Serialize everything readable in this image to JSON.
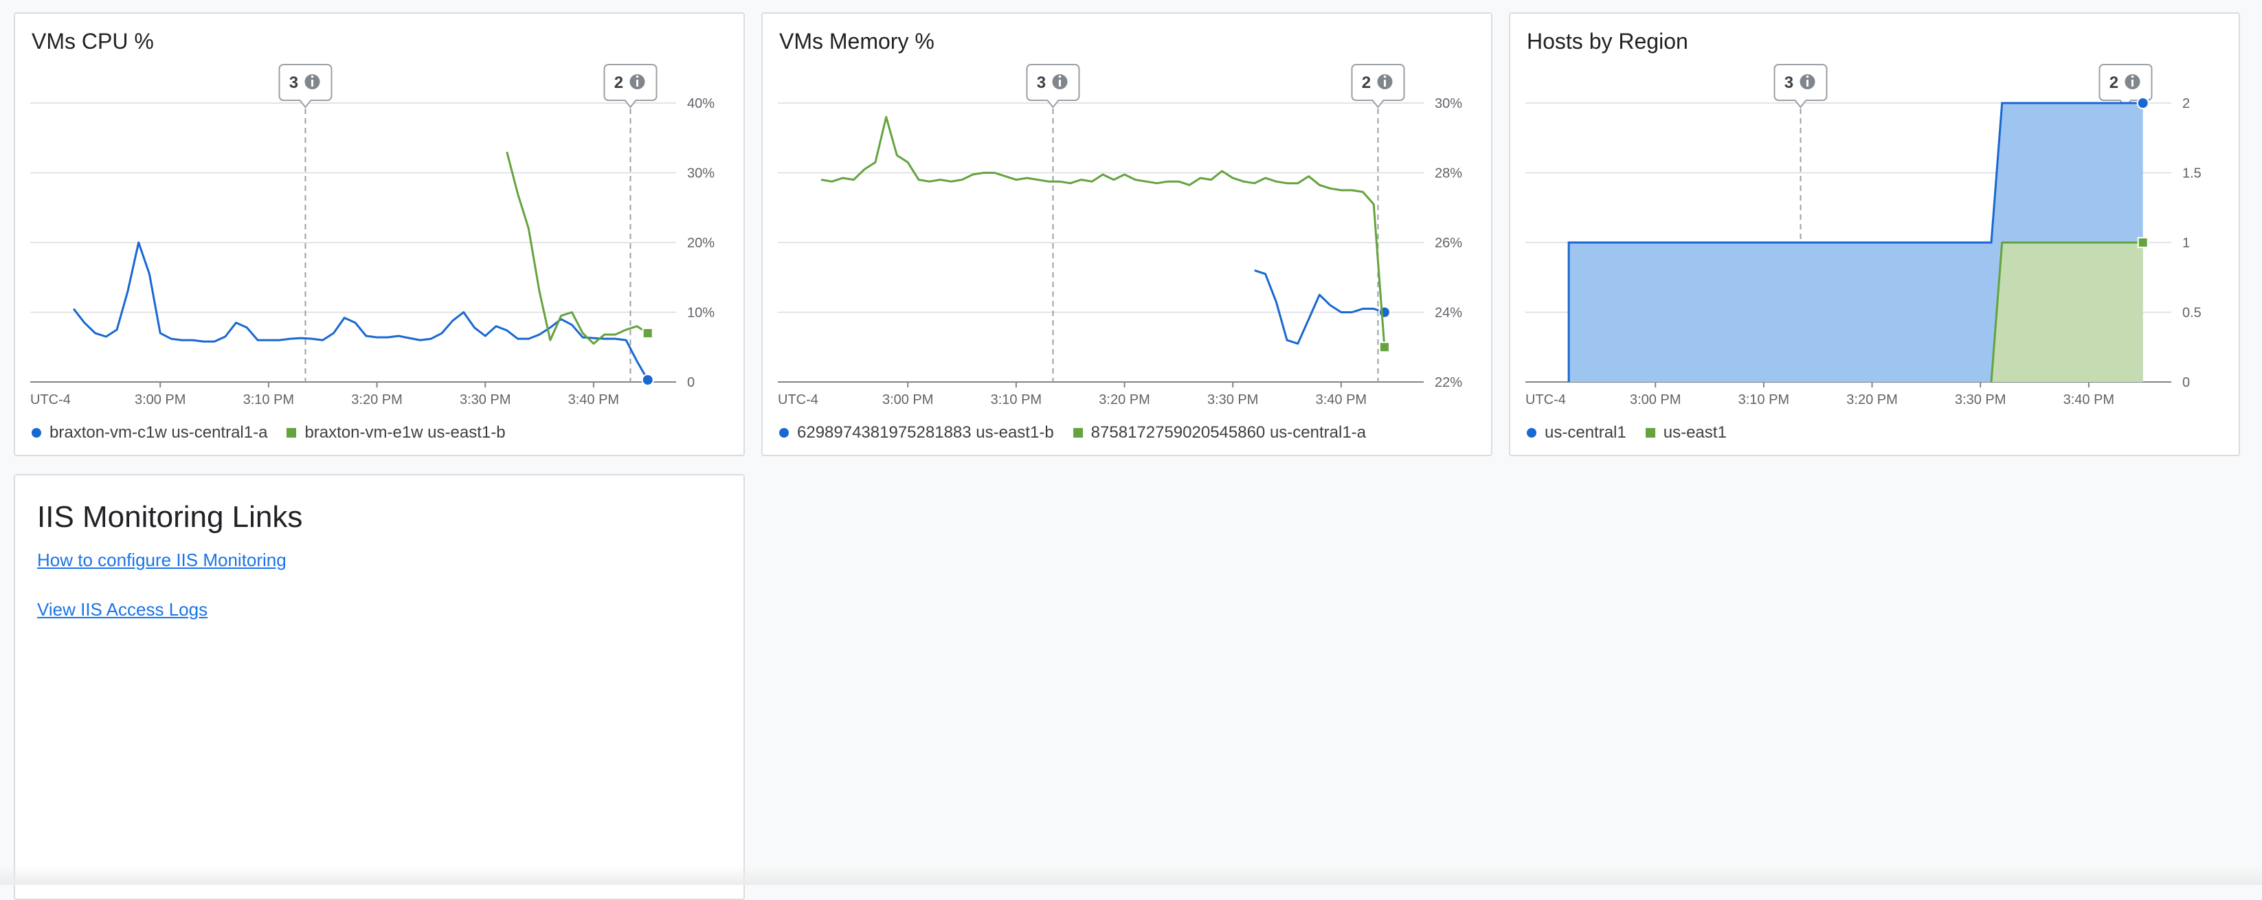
{
  "colors": {
    "blue": "#1967d2",
    "green": "#64a33d",
    "blue_fill": "#9ec5f0",
    "green_fill": "#c5dcb2"
  },
  "cards": [
    {
      "title": "VMs CPU %",
      "legend": [
        {
          "label": "braxton-vm-c1w us-central1-a",
          "shape": "dot",
          "color": "#1967d2"
        },
        {
          "label": "braxton-vm-e1w us-east1-b",
          "shape": "square",
          "color": "#64a33d"
        }
      ]
    },
    {
      "title": "VMs Memory %",
      "legend": [
        {
          "label": "6298974381975281883 us-east1-b",
          "shape": "dot",
          "color": "#1967d2"
        },
        {
          "label": "8758172759020545860 us-central1-a",
          "shape": "square",
          "color": "#64a33d"
        }
      ]
    },
    {
      "title": "Hosts by Region",
      "legend": [
        {
          "label": "us-central1",
          "shape": "dot",
          "color": "#1967d2"
        },
        {
          "label": "us-east1",
          "shape": "square",
          "color": "#64a33d"
        }
      ]
    }
  ],
  "links_card": {
    "title": "IIS Monitoring Links",
    "links": [
      "How to configure IIS Monitoring",
      "View IIS Access Logs"
    ]
  },
  "chart_data": [
    {
      "type": "line",
      "title": "VMs CPU %",
      "x_axis": {
        "timezone_label": "UTC-4",
        "ticks": [
          "3:00 PM",
          "3:10 PM",
          "3:20 PM",
          "3:30 PM",
          "3:40 PM"
        ]
      },
      "xlim": [
        -12,
        48
      ],
      "ylim": [
        0,
        40
      ],
      "y_ticks": [
        0,
        10,
        20,
        30,
        40
      ],
      "y_tick_labels": [
        "0",
        "10%",
        "20%",
        "30%",
        "40%"
      ],
      "annotations": [
        {
          "x": 13.4,
          "label": "3"
        },
        {
          "x": 43.4,
          "label": "2"
        }
      ],
      "series": [
        {
          "name": "braxton-vm-c1w us-central1-a",
          "color": "#1967d2",
          "marker": "dot",
          "x": [
            -8,
            -7,
            -6,
            -5,
            -4,
            -3,
            -2,
            -1,
            0,
            1,
            2,
            3,
            4,
            5,
            6,
            7,
            8,
            9,
            10,
            11,
            12,
            13,
            14,
            15,
            16,
            17,
            18,
            19,
            20,
            21,
            22,
            23,
            24,
            25,
            26,
            27,
            28,
            29,
            30,
            31,
            32,
            33,
            34,
            35,
            36,
            37,
            38,
            39,
            40,
            41,
            42,
            43,
            44,
            45
          ],
          "y": [
            10.5,
            8.5,
            7,
            6.5,
            7.5,
            13,
            20,
            15.5,
            7,
            6.2,
            6,
            6,
            5.8,
            5.8,
            6.5,
            8.5,
            7.8,
            6,
            6,
            6,
            6.2,
            6.3,
            6.2,
            6,
            7,
            9.2,
            8.5,
            6.6,
            6.4,
            6.4,
            6.6,
            6.3,
            6,
            6.2,
            7,
            8.8,
            10,
            7.8,
            6.6,
            8,
            7.4,
            6.2,
            6.2,
            6.8,
            7.8,
            9,
            8.2,
            6.4,
            6.3,
            6.2,
            6.2,
            6,
            3,
            0.3
          ]
        },
        {
          "name": "braxton-vm-e1w us-east1-b",
          "color": "#64a33d",
          "marker": "square",
          "x": [
            32,
            33,
            34,
            35,
            36,
            37,
            38,
            39,
            40,
            41,
            42,
            43,
            44,
            45
          ],
          "y": [
            33,
            27,
            22,
            13,
            6,
            9.5,
            10,
            7,
            5.5,
            6.8,
            6.8,
            7.5,
            8,
            7
          ]
        }
      ]
    },
    {
      "type": "line",
      "title": "VMs Memory %",
      "x_axis": {
        "timezone_label": "UTC-4",
        "ticks": [
          "3:00 PM",
          "3:10 PM",
          "3:20 PM",
          "3:30 PM",
          "3:40 PM"
        ]
      },
      "xlim": [
        -12,
        48
      ],
      "ylim": [
        22,
        30
      ],
      "y_ticks": [
        22,
        24,
        26,
        28,
        30
      ],
      "y_tick_labels": [
        "22%",
        "24%",
        "26%",
        "28%",
        "30%"
      ],
      "annotations": [
        {
          "x": 13.4,
          "label": "3"
        },
        {
          "x": 43.4,
          "label": "2"
        }
      ],
      "series": [
        {
          "name": "6298974381975281883 us-east1-b",
          "color": "#1967d2",
          "marker": "dot",
          "x": [
            32,
            33,
            34,
            35,
            36,
            37,
            38,
            39,
            40,
            41,
            42,
            43,
            44
          ],
          "y": [
            25.2,
            25.1,
            24.3,
            23.2,
            23.1,
            23.8,
            24.5,
            24.2,
            24,
            24,
            24.1,
            24.1,
            24
          ]
        },
        {
          "name": "8758172759020545860 us-central1-a",
          "color": "#64a33d",
          "marker": "square",
          "x": [
            -8,
            -7,
            -6,
            -5,
            -4,
            -3,
            -2,
            -1,
            0,
            1,
            2,
            3,
            4,
            5,
            6,
            7,
            8,
            9,
            10,
            11,
            12,
            13,
            14,
            15,
            16,
            17,
            18,
            19,
            20,
            21,
            22,
            23,
            24,
            25,
            26,
            27,
            28,
            29,
            30,
            31,
            32,
            33,
            34,
            35,
            36,
            37,
            38,
            39,
            40,
            41,
            42,
            43,
            44
          ],
          "y": [
            27.8,
            27.75,
            27.85,
            27.8,
            28.1,
            28.3,
            29.6,
            28.5,
            28.3,
            27.8,
            27.75,
            27.8,
            27.75,
            27.8,
            27.95,
            28,
            28,
            27.9,
            27.8,
            27.85,
            27.8,
            27.75,
            27.75,
            27.7,
            27.8,
            27.75,
            27.95,
            27.8,
            27.95,
            27.8,
            27.75,
            27.7,
            27.75,
            27.75,
            27.65,
            27.85,
            27.8,
            28.05,
            27.85,
            27.75,
            27.7,
            27.85,
            27.75,
            27.7,
            27.7,
            27.9,
            27.65,
            27.55,
            27.5,
            27.5,
            27.45,
            27.1,
            23
          ]
        }
      ]
    },
    {
      "type": "area",
      "title": "Hosts by Region",
      "x_axis": {
        "timezone_label": "UTC-4",
        "ticks": [
          "3:00 PM",
          "3:10 PM",
          "3:20 PM",
          "3:30 PM",
          "3:40 PM"
        ]
      },
      "xlim": [
        -12,
        48
      ],
      "ylim": [
        0,
        2
      ],
      "y_ticks": [
        0,
        0.5,
        1,
        1.5,
        2
      ],
      "y_tick_labels": [
        "0",
        "0.5",
        "1",
        "1.5",
        "2"
      ],
      "annotations": [
        {
          "x": 13.4,
          "label": "3"
        },
        {
          "x": 43.4,
          "label": "2"
        }
      ],
      "series": [
        {
          "name": "us-central1",
          "color": "#1967d2",
          "fill": "#9ec5f0",
          "marker": "dot",
          "x": [
            -8,
            -8,
            31,
            32,
            45,
            45
          ],
          "y": [
            0,
            1,
            1,
            2,
            2,
            0
          ]
        },
        {
          "name": "us-east1",
          "color": "#64a33d",
          "fill": "#c5dcb2",
          "marker": "square",
          "x": [
            31,
            32,
            45,
            45
          ],
          "y": [
            0,
            1,
            1,
            0
          ]
        }
      ]
    }
  ]
}
